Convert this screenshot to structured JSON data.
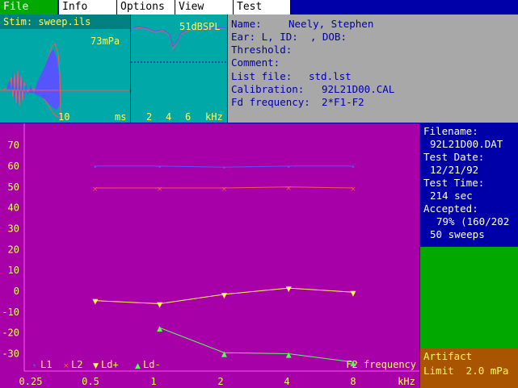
{
  "menu": [
    "File",
    "Info",
    "Options",
    "View",
    "Test"
  ],
  "stim_panel": {
    "title": "Stim: sweep.ils",
    "level": "73mPa",
    "xtick": "10",
    "xunit": "ms"
  },
  "dp_panel": {
    "level": "51dBSPL",
    "xticks": [
      "2",
      "4",
      "6"
    ],
    "xunit": "kHz"
  },
  "info": {
    "name_label": "Name:",
    "name_value": "Neely, Stephen",
    "ear_line": "Ear: L, ID:  , DOB:",
    "threshold_label": "Threshold:",
    "comment_label": "Comment:",
    "list_file_label": "List file:",
    "list_file_value": "std.lst",
    "calibration_label": "Calibration:",
    "calibration_value": "92L21D00.CAL",
    "fd_label": "Fd frequency:",
    "fd_value": "2*F1-F2"
  },
  "side": {
    "filename_label": "Filename:",
    "filename_value": "92L21D00.DAT",
    "date_label": "Test Date:",
    "date_value": "12/21/92",
    "time_label": "Test Time:",
    "time_value": "214 sec",
    "accepted_label": "Accepted:",
    "accepted_value": "79% (160/202",
    "sweeps_value": "50 sweeps"
  },
  "artifact": {
    "label": "Artifact",
    "limit_text": "Limit  2.0 mPa"
  },
  "chart_data": {
    "type": "line",
    "ylim": [
      -35,
      75
    ],
    "yticks": [
      70,
      60,
      50,
      40,
      30,
      20,
      10,
      0,
      -10,
      -20,
      -30
    ],
    "xticklabels": [
      "0.25",
      "0.5",
      "1",
      "2",
      "4",
      "8"
    ],
    "xunit": "kHz",
    "xlabel": "F2 frequency",
    "x": [
      0.5,
      1,
      2,
      4,
      8
    ],
    "series": [
      {
        "name": "L1",
        "marker": "•",
        "color": "#5555ff",
        "values": [
          60,
          60,
          59.5,
          60,
          60
        ]
      },
      {
        "name": "L2",
        "marker": "×",
        "color": "#ff5555",
        "values": [
          49.5,
          49.5,
          49.5,
          50,
          49.5
        ]
      },
      {
        "name": "Ld+",
        "marker": "▼",
        "color": "#ffff55",
        "values": [
          -4.5,
          -6,
          -1.5,
          1.5,
          -0.5
        ]
      },
      {
        "name": "Ld-",
        "marker": "▲",
        "color": "#55ff55",
        "values": [
          null,
          -17.5,
          -29.5,
          -30,
          -34
        ]
      }
    ]
  }
}
